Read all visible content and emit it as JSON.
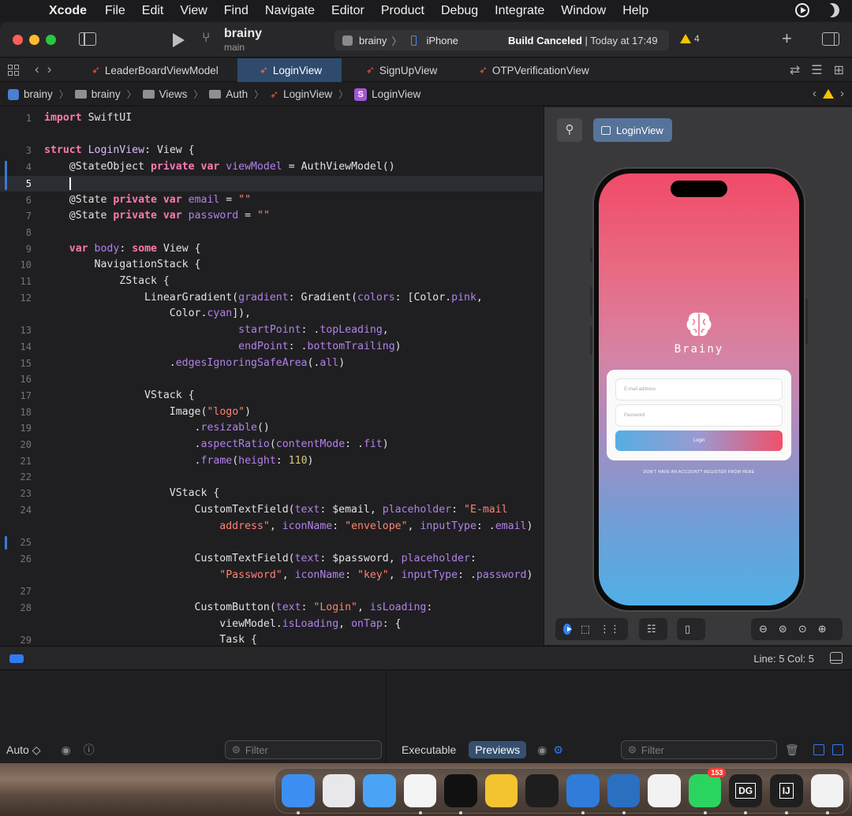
{
  "menubar": {
    "app": "Xcode",
    "items": [
      "File",
      "Edit",
      "View",
      "Find",
      "Navigate",
      "Editor",
      "Product",
      "Debug",
      "Integrate",
      "Window",
      "Help"
    ]
  },
  "toolbar": {
    "project": "brainy",
    "branch": "main",
    "scheme_app": "brainy",
    "scheme_device": "iPhone",
    "status_bold": "Build Canceled",
    "status_rest": " | Today at 17:49",
    "warning_count": "4"
  },
  "tabs": [
    "LeaderBoardViewModel",
    "LoginView",
    "SignUpView",
    "OTPVerificationView"
  ],
  "breadcrumb": [
    "brainy",
    "brainy",
    "Views",
    "Auth",
    "LoginView",
    "LoginView"
  ],
  "code_lines": [
    {
      "n": "1",
      "tokens": [
        [
          "k",
          "import"
        ],
        [
          "pl",
          " SwiftUI"
        ]
      ]
    },
    {
      "n": "",
      "tokens": []
    },
    {
      "n": "3",
      "tokens": [
        [
          "k",
          "struct"
        ],
        [
          "pl",
          " "
        ],
        [
          "t",
          "LoginView"
        ],
        [
          "pl",
          ": View {"
        ]
      ]
    },
    {
      "n": "4",
      "tokens": [
        [
          "pl",
          "    @StateObject "
        ],
        [
          "k",
          "private var"
        ],
        [
          "pl",
          " "
        ],
        [
          "p",
          "viewModel"
        ],
        [
          "pl",
          " = AuthViewModel()"
        ]
      ]
    },
    {
      "n": "5",
      "tokens": []
    },
    {
      "n": "6",
      "tokens": [
        [
          "pl",
          "    @State "
        ],
        [
          "k",
          "private var"
        ],
        [
          "pl",
          " "
        ],
        [
          "p",
          "email"
        ],
        [
          "pl",
          " = "
        ],
        [
          "s",
          "\"\""
        ]
      ]
    },
    {
      "n": "7",
      "tokens": [
        [
          "pl",
          "    @State "
        ],
        [
          "k",
          "private var"
        ],
        [
          "pl",
          " "
        ],
        [
          "p",
          "password"
        ],
        [
          "pl",
          " = "
        ],
        [
          "s",
          "\"\""
        ]
      ]
    },
    {
      "n": "8",
      "tokens": []
    },
    {
      "n": "9",
      "tokens": [
        [
          "pl",
          "    "
        ],
        [
          "k",
          "var"
        ],
        [
          "pl",
          " "
        ],
        [
          "p",
          "body"
        ],
        [
          "pl",
          ": "
        ],
        [
          "k",
          "some"
        ],
        [
          "pl",
          " View {"
        ]
      ]
    },
    {
      "n": "10",
      "tokens": [
        [
          "pl",
          "        NavigationStack {"
        ]
      ]
    },
    {
      "n": "11",
      "tokens": [
        [
          "pl",
          "            ZStack {"
        ]
      ]
    },
    {
      "n": "12",
      "tokens": [
        [
          "pl",
          "                LinearGradient("
        ],
        [
          "p",
          "gradient"
        ],
        [
          "pl",
          ": Gradient("
        ],
        [
          "p",
          "colors"
        ],
        [
          "pl",
          ": [Color."
        ],
        [
          "p",
          "pink"
        ],
        [
          "pl",
          ","
        ]
      ]
    },
    {
      "n": "",
      "tokens": [
        [
          "pl",
          "                    Color."
        ],
        [
          "p",
          "cyan"
        ],
        [
          "pl",
          "]),"
        ]
      ]
    },
    {
      "n": "13",
      "tokens": [
        [
          "pl",
          "                               "
        ],
        [
          "p",
          "startPoint"
        ],
        [
          "pl",
          ": ."
        ],
        [
          "p",
          "topLeading"
        ],
        [
          "pl",
          ","
        ]
      ]
    },
    {
      "n": "14",
      "tokens": [
        [
          "pl",
          "                               "
        ],
        [
          "p",
          "endPoint"
        ],
        [
          "pl",
          ": ."
        ],
        [
          "p",
          "bottomTrailing"
        ],
        [
          "pl",
          ")"
        ]
      ]
    },
    {
      "n": "15",
      "tokens": [
        [
          "pl",
          "                    ."
        ],
        [
          "p",
          "edgesIgnoringSafeArea"
        ],
        [
          "pl",
          "(."
        ],
        [
          "p",
          "all"
        ],
        [
          "pl",
          ")"
        ]
      ]
    },
    {
      "n": "16",
      "tokens": []
    },
    {
      "n": "17",
      "tokens": [
        [
          "pl",
          "                VStack {"
        ]
      ]
    },
    {
      "n": "18",
      "tokens": [
        [
          "pl",
          "                    Image("
        ],
        [
          "s",
          "\"logo\""
        ],
        [
          "pl",
          ")"
        ]
      ]
    },
    {
      "n": "19",
      "tokens": [
        [
          "pl",
          "                        ."
        ],
        [
          "p",
          "resizable"
        ],
        [
          "pl",
          "()"
        ]
      ]
    },
    {
      "n": "20",
      "tokens": [
        [
          "pl",
          "                        ."
        ],
        [
          "p",
          "aspectRatio"
        ],
        [
          "pl",
          "("
        ],
        [
          "p",
          "contentMode"
        ],
        [
          "pl",
          ": ."
        ],
        [
          "p",
          "fit"
        ],
        [
          "pl",
          ")"
        ]
      ]
    },
    {
      "n": "21",
      "tokens": [
        [
          "pl",
          "                        ."
        ],
        [
          "p",
          "frame"
        ],
        [
          "pl",
          "("
        ],
        [
          "p",
          "height"
        ],
        [
          "pl",
          ": "
        ],
        [
          "n",
          "110"
        ],
        [
          "pl",
          ")"
        ]
      ]
    },
    {
      "n": "22",
      "tokens": []
    },
    {
      "n": "23",
      "tokens": [
        [
          "pl",
          "                    VStack {"
        ]
      ]
    },
    {
      "n": "24",
      "tokens": [
        [
          "pl",
          "                        CustomTextField("
        ],
        [
          "p",
          "text"
        ],
        [
          "pl",
          ": $email, "
        ],
        [
          "p",
          "placeholder"
        ],
        [
          "pl",
          ": "
        ],
        [
          "s",
          "\"E-mail"
        ]
      ]
    },
    {
      "n": "",
      "tokens": [
        [
          "s",
          "                            address\""
        ],
        [
          "pl",
          ", "
        ],
        [
          "p",
          "iconName"
        ],
        [
          "pl",
          ": "
        ],
        [
          "s",
          "\"envelope\""
        ],
        [
          "pl",
          ", "
        ],
        [
          "p",
          "inputType"
        ],
        [
          "pl",
          ": ."
        ],
        [
          "p",
          "email"
        ],
        [
          "pl",
          ")"
        ]
      ]
    },
    {
      "n": "25",
      "tokens": []
    },
    {
      "n": "26",
      "tokens": [
        [
          "pl",
          "                        CustomTextField("
        ],
        [
          "p",
          "text"
        ],
        [
          "pl",
          ": $password, "
        ],
        [
          "p",
          "placeholder"
        ],
        [
          "pl",
          ":"
        ]
      ]
    },
    {
      "n": "",
      "tokens": [
        [
          "s",
          "                            \"Password\""
        ],
        [
          "pl",
          ", "
        ],
        [
          "p",
          "iconName"
        ],
        [
          "pl",
          ": "
        ],
        [
          "s",
          "\"key\""
        ],
        [
          "pl",
          ", "
        ],
        [
          "p",
          "inputType"
        ],
        [
          "pl",
          ": ."
        ],
        [
          "p",
          "password"
        ],
        [
          "pl",
          ")"
        ]
      ]
    },
    {
      "n": "27",
      "tokens": []
    },
    {
      "n": "28",
      "tokens": [
        [
          "pl",
          "                        CustomButton("
        ],
        [
          "p",
          "text"
        ],
        [
          "pl",
          ": "
        ],
        [
          "s",
          "\"Login\""
        ],
        [
          "pl",
          ", "
        ],
        [
          "p",
          "isLoading"
        ],
        [
          "pl",
          ":"
        ]
      ]
    },
    {
      "n": "",
      "tokens": [
        [
          "pl",
          "                            viewModel."
        ],
        [
          "p",
          "isLoading"
        ],
        [
          "pl",
          ", "
        ],
        [
          "p",
          "onTap"
        ],
        [
          "pl",
          ": {"
        ]
      ]
    },
    {
      "n": "29",
      "tokens": [
        [
          "pl",
          "                            Task {"
        ]
      ]
    }
  ],
  "canvas": {
    "preview_name": "LoginView",
    "app_name": "Brainy",
    "email_placeholder": "E-mail address",
    "password_placeholder": "Password",
    "login_label": "Login",
    "signup_text": "DON'T HAVE AN ACCOUNT? REGISTER FROM HERE"
  },
  "status": {
    "line_col": "Line: 5  Col: 5"
  },
  "debug": {
    "auto_label": "Auto ◇",
    "filter_placeholder": "Filter",
    "seg_executable": "Executable",
    "seg_previews": "Previews",
    "filter2_placeholder": "Filter"
  },
  "dock": {
    "apps": [
      {
        "name": "Finder",
        "label": "",
        "color": "#3d8ff2"
      },
      {
        "name": "Launchpad",
        "label": "",
        "color": "#e8e8ea"
      },
      {
        "name": "Mail",
        "label": "",
        "color": "#4aa3f5"
      },
      {
        "name": "Craft",
        "label": "",
        "color": "#f4f4f4"
      },
      {
        "name": "Notes",
        "label": "",
        "color": "#111111"
      },
      {
        "name": "TablePlus",
        "label": "",
        "color": "#f3c330"
      },
      {
        "name": "Figma",
        "label": "",
        "color": "#1e1e1e"
      },
      {
        "name": "Xcode",
        "label": "",
        "color": "#2f7dd8"
      },
      {
        "name": "VS Code",
        "label": "",
        "color": "#2b6fc0"
      },
      {
        "name": "Toolbox",
        "label": "",
        "color": "#f2f2f2"
      },
      {
        "name": "WhatsApp",
        "label": "",
        "color": "#2bd45e"
      },
      {
        "name": "DataGrip",
        "label": "DG",
        "color": "#1f1f1f"
      },
      {
        "name": "IntelliJ",
        "label": "IJ",
        "color": "#1f1f1f"
      },
      {
        "name": "Chrome",
        "label": "",
        "color": "#f2f2f2"
      }
    ],
    "whatsapp_badge": "153"
  }
}
